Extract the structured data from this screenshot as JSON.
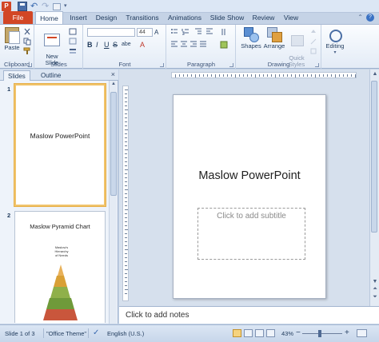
{
  "title_bar": {
    "app_icon_letter": "P"
  },
  "ribbon_tabs": [
    {
      "label": "File"
    },
    {
      "label": "Home"
    },
    {
      "label": "Insert"
    },
    {
      "label": "Design"
    },
    {
      "label": "Transitions"
    },
    {
      "label": "Animations"
    },
    {
      "label": "Slide Show"
    },
    {
      "label": "Review"
    },
    {
      "label": "View"
    }
  ],
  "ribbon": {
    "clipboard": {
      "paste_label": "Paste",
      "group_label": "Clipboard"
    },
    "slides": {
      "new_slide_label": "New\nSlide",
      "group_label": "Slides"
    },
    "font": {
      "size_value": "44",
      "bold": "B",
      "italic": "I",
      "underline": "U",
      "strike": "S",
      "shadow": "abe",
      "group_label": "Font"
    },
    "paragraph": {
      "group_label": "Paragraph"
    },
    "drawing": {
      "shapes_label": "Shapes",
      "arrange_label": "Arrange",
      "quick_styles_label": "Quick\nStyles",
      "group_label": "Drawing"
    },
    "editing": {
      "label": "Editing"
    }
  },
  "left_panel": {
    "tabs": [
      {
        "label": "Slides"
      },
      {
        "label": "Outline"
      }
    ],
    "close_glyph": "×",
    "slides": [
      {
        "number": "1",
        "title": "Maslow PowerPoint"
      },
      {
        "number": "2",
        "title": "Maslow Pyramid Chart",
        "pyramid_caption": "Maslow's\nHierarchy\nof Needs"
      }
    ]
  },
  "slide_canvas": {
    "title": "Maslow PowerPoint",
    "subtitle_placeholder": "Click to add subtitle"
  },
  "notes": {
    "placeholder": "Click to add notes"
  },
  "status_bar": {
    "slide_info": "Slide 1 of 3",
    "theme": "\"Office Theme\"",
    "language": "English (U.S.)",
    "zoom": "43%",
    "zoom_minus": "−",
    "zoom_plus": "+"
  },
  "colors": {
    "file_tab": "#d24625",
    "selected_thumb_border": "#f0c36a",
    "pyramid_layers": [
      "#e8b15a",
      "#d9a036",
      "#8fb04a",
      "#6f9a3a",
      "#c9563c"
    ]
  }
}
